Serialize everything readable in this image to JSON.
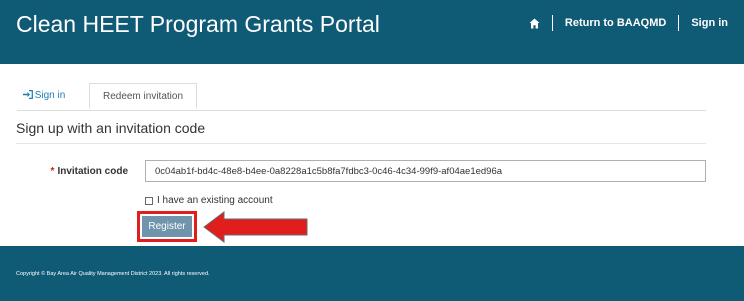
{
  "header": {
    "title": "Clean HEET Program Grants Portal",
    "nav": {
      "home_icon": "home-icon",
      "return_label": "Return to BAAQMD",
      "signin_label": "Sign in"
    }
  },
  "tabs": {
    "signin": {
      "label": "Sign in",
      "icon": "sign-in-icon"
    },
    "redeem": {
      "label": "Redeem invitation",
      "active": true
    }
  },
  "form": {
    "title": "Sign up with an invitation code",
    "required_marker": "*",
    "code_label": "Invitation code",
    "code_value": "0c04ab1f-bd4c-48e8-b4ee-0a8228a1c5b8fa7fdbc3-0c46-4c34-99f9-af04ae1ed96a",
    "existing_account_label": "I have an existing account",
    "existing_account_checked": false,
    "register_label": "Register"
  },
  "annotation": {
    "highlight_color": "#e01e1e",
    "arrow_color": "#e01e1e"
  },
  "footer": {
    "copyright": "Copyright © Bay Area Air Quality Management District 2023. All rights reserved."
  },
  "colors": {
    "brand": "#0f5a74",
    "link": "#1f7db5",
    "button": "#6f94ab",
    "required": "#c41f1f"
  }
}
